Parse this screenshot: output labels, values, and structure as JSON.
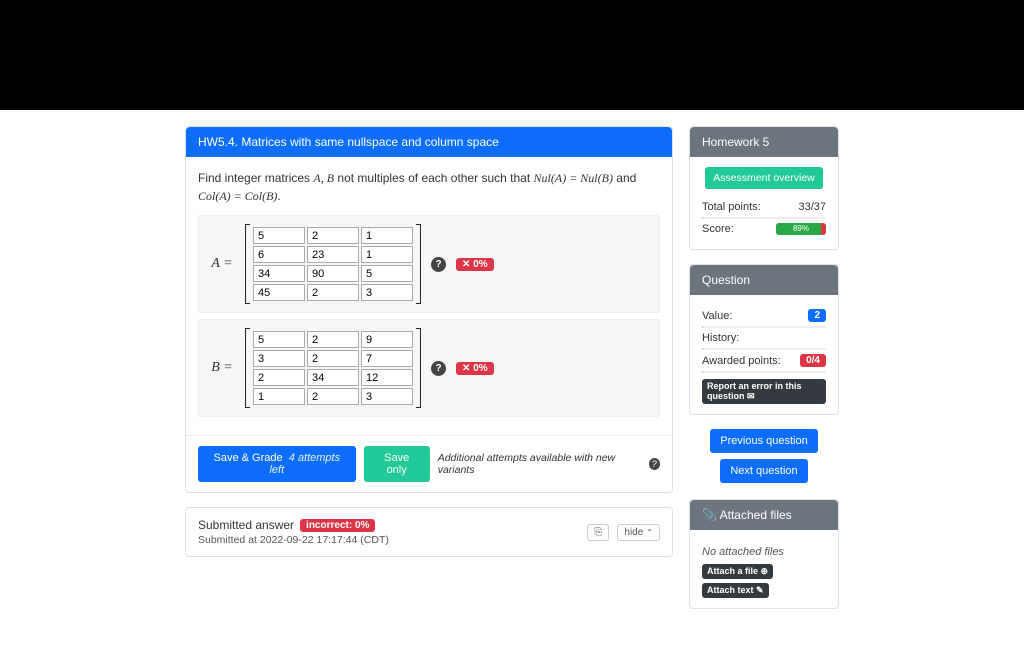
{
  "question_header": "HW5.4. Matrices with same nullspace and column space",
  "question_text_1": "Find integer matrices ",
  "question_text_2": " not multiples of each other such that ",
  "question_text_3": " and ",
  "matrixA": {
    "label": "A =",
    "cells": [
      "5",
      "2",
      "1",
      "6",
      "23",
      "1",
      "34",
      "90",
      "5",
      "45",
      "2",
      "3"
    ],
    "score": "✕ 0%"
  },
  "matrixB": {
    "label": "B =",
    "cells": [
      "5",
      "2",
      "9",
      "3",
      "2",
      "7",
      "2",
      "34",
      "12",
      "1",
      "2",
      "3"
    ],
    "score": "✕ 0%"
  },
  "buttons": {
    "save_grade": "Save & Grade",
    "attempts_left": "4 attempts left",
    "save_only": "Save only",
    "variant_note": "Additional attempts available with new variants"
  },
  "submitted": {
    "title": "Submitted answer",
    "badge": "incorrect: 0%",
    "timestamp": "Submitted at 2022-09-22 17:17:44 (CDT)",
    "hide": "hide"
  },
  "sidebar": {
    "hw_title": "Homework 5",
    "assessment_btn": "Assessment overview",
    "total_points_label": "Total points:",
    "total_points_value": "33/37",
    "score_label": "Score:",
    "score_pct": "89%",
    "question_header": "Question",
    "value_label": "Value:",
    "value_badge": "2",
    "history_label": "History:",
    "awarded_label": "Awarded points:",
    "awarded_badge": "0/4",
    "report_error": "Report an error in this question ✉",
    "prev_btn": "Previous question",
    "next_btn": "Next question",
    "attached_header": "Attached files",
    "no_files": "No attached files",
    "attach_file": "Attach a file ⊕",
    "attach_text": "Attach text ✎"
  }
}
